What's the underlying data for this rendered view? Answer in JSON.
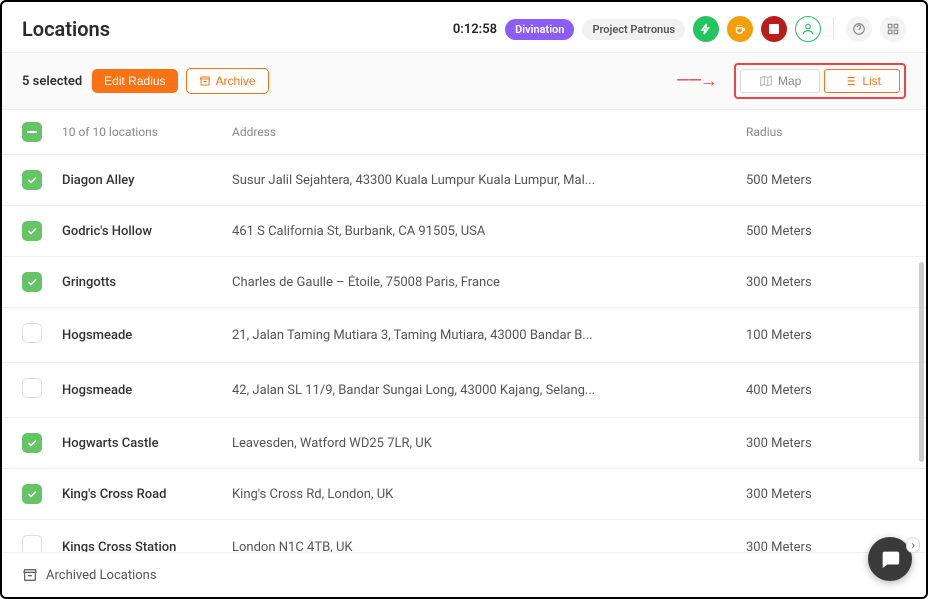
{
  "header": {
    "title": "Locations",
    "timer": "0:12:58",
    "tag1": "Divination",
    "tag2": "Project Patronus"
  },
  "toolbar": {
    "selected_text": "5 selected",
    "edit_radius": "Edit Radius",
    "archive": "Archive",
    "map": "Map",
    "list": "List"
  },
  "columns": {
    "count": "10 of 10 locations",
    "address": "Address",
    "radius": "Radius"
  },
  "rows": [
    {
      "checked": true,
      "name": "Diagon Alley",
      "address": "Susur Jalil Sejahtera, 43300 Kuala Lumpur Kuala Lumpur, Mal...",
      "radius": "500 Meters"
    },
    {
      "checked": true,
      "name": "Godric's Hollow",
      "address": "461 S California St, Burbank, CA 91505, USA",
      "radius": "500 Meters"
    },
    {
      "checked": true,
      "name": "Gringotts",
      "address": "Charles de Gaulle – Étoile, 75008 Paris, France",
      "radius": "300 Meters"
    },
    {
      "checked": false,
      "name": "Hogsmeade",
      "address": "21, Jalan Taming Mutiara 3, Taming Mutiara, 43000 Bandar B...",
      "radius": "100 Meters"
    },
    {
      "checked": false,
      "name": "Hogsmeade",
      "address": "42, Jalan SL 11/9, Bandar Sungai Long, 43000 Kajang, Selang...",
      "radius": "400 Meters"
    },
    {
      "checked": true,
      "name": "Hogwarts Castle",
      "address": "Leavesden, Watford WD25 7LR, UK",
      "radius": "300 Meters"
    },
    {
      "checked": true,
      "name": "King's Cross Road",
      "address": "King's Cross Rd, London, UK",
      "radius": "300 Meters"
    },
    {
      "checked": false,
      "name": "Kings Cross Station",
      "address": "London N1C 4TB, UK",
      "radius": "300 Meters"
    }
  ],
  "archived_label": "Archived Locations"
}
